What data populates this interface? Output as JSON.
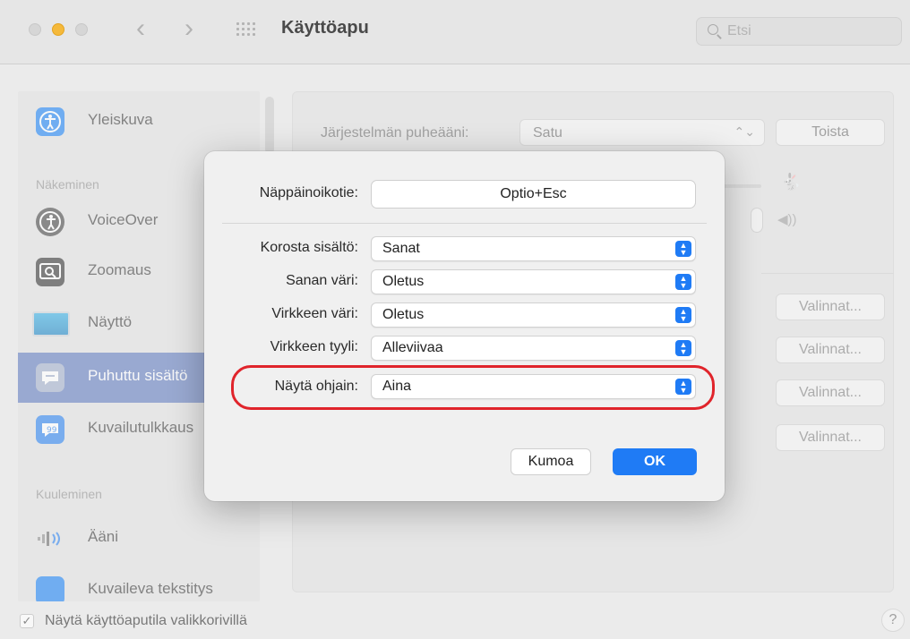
{
  "window": {
    "title": "Käyttöapu",
    "search_placeholder": "Etsi"
  },
  "sidebar": {
    "items": [
      {
        "label": "Yleiskuva",
        "icon": "accessibility-icon",
        "color": "#2f8df5"
      },
      {
        "label": "VoiceOver",
        "icon": "voiceover-icon",
        "color": "#555555"
      },
      {
        "label": "Zoomaus",
        "icon": "zoom-icon",
        "color": "#444444"
      },
      {
        "label": "Näyttö",
        "icon": "display-icon",
        "color": "#39a5d8"
      },
      {
        "label": "Puhuttu sisältö",
        "icon": "spoken-content-icon",
        "color": "#9aa7c6"
      },
      {
        "label": "Kuvailutulkkaus",
        "icon": "audio-description-icon",
        "color": "#3c8cf0"
      },
      {
        "label": "Ääni",
        "icon": "audio-icon",
        "color": "#888888"
      },
      {
        "label": "Kuvaileva tekstitys",
        "icon": "captions-icon",
        "color": "#2f8df5"
      }
    ],
    "sections": {
      "vision": "Näkeminen",
      "hearing": "Kuuleminen"
    },
    "selected_index": 4
  },
  "main": {
    "voice_label": "Järjestelmän puheääni:",
    "voice_value": "Satu",
    "play_label": "Toista",
    "options_label": "Valinnat..."
  },
  "dialog": {
    "shortcut_label": "Näppäinoikotie:",
    "shortcut_value": "Optio+Esc",
    "rows": [
      {
        "label": "Korosta sisältö:",
        "value": "Sanat"
      },
      {
        "label": "Sanan väri:",
        "value": "Oletus"
      },
      {
        "label": "Virkkeen väri:",
        "value": "Oletus"
      },
      {
        "label": "Virkkeen tyyli:",
        "value": "Alleviivaa"
      },
      {
        "label": "Näytä ohjain:",
        "value": "Aina"
      }
    ],
    "cancel_label": "Kumoa",
    "ok_label": "OK",
    "accent": "#1f7bf5",
    "highlight_color": "#e0242b"
  },
  "footer": {
    "menu_checkbox_label": "Näytä käyttöaputila valikkorivillä",
    "menu_checkbox_checked": true,
    "help_label": "?"
  }
}
